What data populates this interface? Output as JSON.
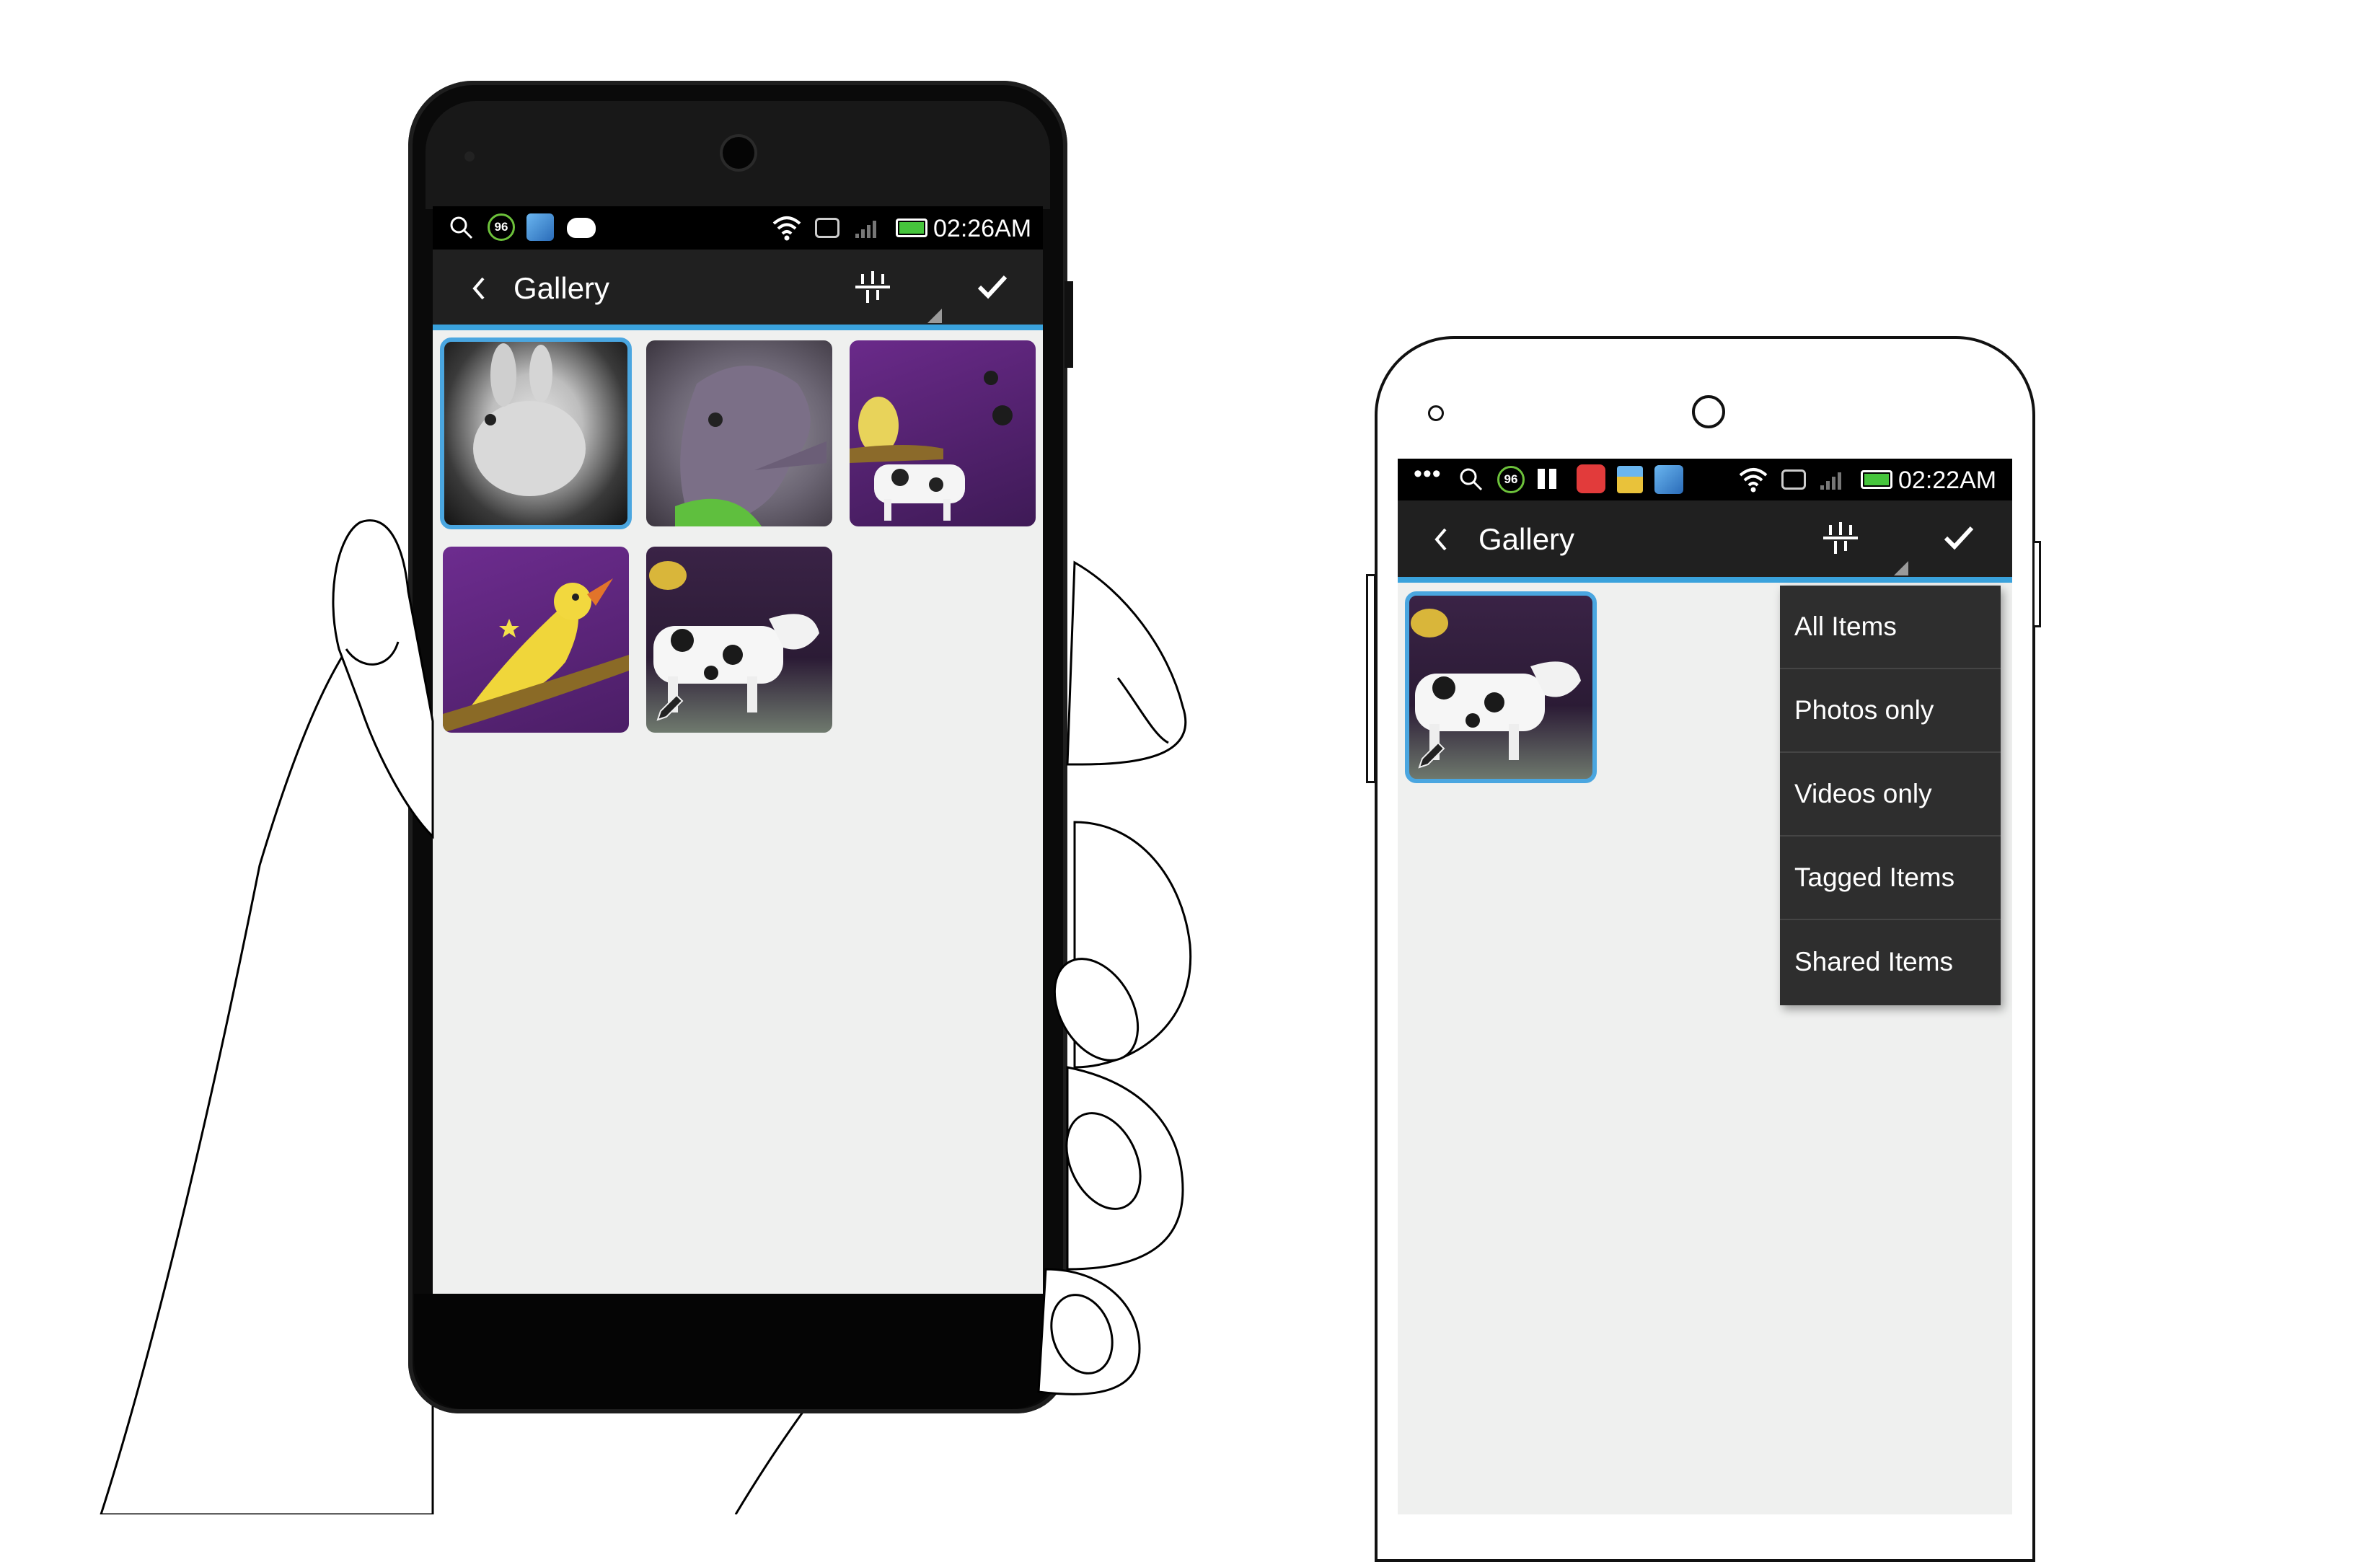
{
  "left_phone": {
    "status": {
      "time": "02:26AM",
      "badge": "96"
    },
    "appbar": {
      "title": "Gallery"
    },
    "thumbnails": [
      {
        "subject": "white-bunny",
        "selected": true
      },
      {
        "subject": "purple-elephant",
        "selected": false
      },
      {
        "subject": "bird-and-cow-scene",
        "selected": false
      },
      {
        "subject": "yellow-bird",
        "selected": false
      },
      {
        "subject": "cow-with-edit-icon",
        "selected": false
      }
    ]
  },
  "right_phone": {
    "status": {
      "time": "02:22AM",
      "badge": "96"
    },
    "appbar": {
      "title": "Gallery"
    },
    "thumbnails": [
      {
        "subject": "cow-with-edit-icon",
        "selected": true
      }
    ],
    "filter_menu": {
      "items": [
        "All Items",
        "Photos only",
        "Videos only",
        "Tagged Items",
        "Shared Items"
      ]
    }
  },
  "colors": {
    "accent": "#3aa2dc",
    "appbar": "#202020",
    "content_bg": "#eff0ef",
    "menu_bg": "#2e2e2e"
  },
  "icons": [
    "back-chevron-icon",
    "filter-sort-icon",
    "checkmark-icon",
    "search-icon",
    "wifi-icon",
    "battery-icon",
    "pencil-edit-icon"
  ]
}
